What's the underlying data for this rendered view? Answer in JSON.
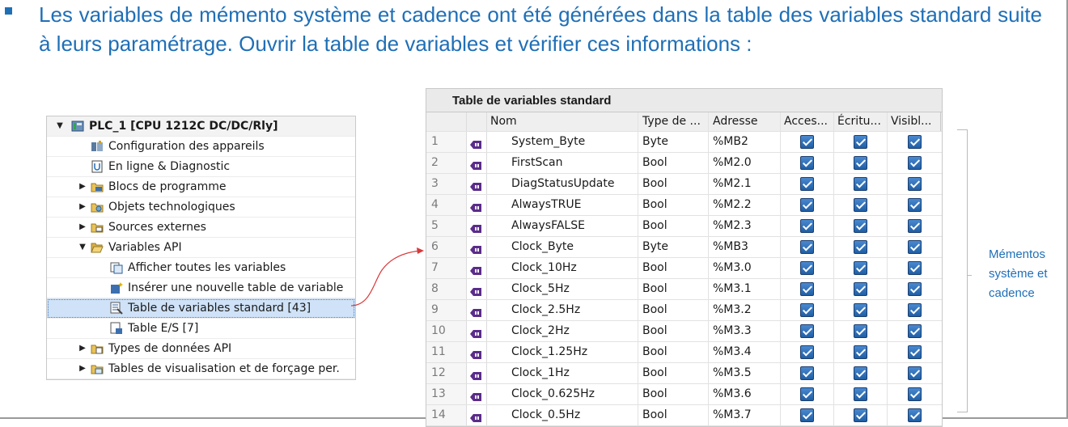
{
  "instruction": {
    "text": "Les variables de mémento système et cadence ont été générées dans la table des variables standard suite à leurs paramétrage. Ouvrir la table de variables et vérifier ces informations :",
    "color": "#1f6fb7"
  },
  "project_tree": {
    "root": {
      "label": "PLC_1 [CPU 1212C DC/DC/Rly]",
      "expanded": true,
      "icon": "plc-icon"
    },
    "items": [
      {
        "label": "Configuration des appareils",
        "level": 1,
        "icon": "device-config-icon",
        "expander": "none"
      },
      {
        "label": "En ligne & Diagnostic",
        "level": 1,
        "icon": "online-diagnostic-icon",
        "expander": "none"
      },
      {
        "label": "Blocs de programme",
        "level": 1,
        "icon": "folder-blocks-icon",
        "expander": "collapsed"
      },
      {
        "label": "Objets technologiques",
        "level": 1,
        "icon": "folder-tech-icon",
        "expander": "collapsed"
      },
      {
        "label": "Sources externes",
        "level": 1,
        "icon": "folder-sources-icon",
        "expander": "collapsed"
      },
      {
        "label": "Variables API",
        "level": 1,
        "icon": "folder-open-icon",
        "expander": "expanded"
      },
      {
        "label": "Afficher toutes les variables",
        "level": 2,
        "icon": "show-all-vars-icon",
        "expander": "none"
      },
      {
        "label": "Insérer une nouvelle table de variable",
        "level": 2,
        "icon": "insert-table-icon",
        "expander": "none"
      },
      {
        "label": "Table de variables standard [43]",
        "level": 2,
        "icon": "var-table-icon",
        "expander": "none",
        "selected": true
      },
      {
        "label": "Table E/S [7]",
        "level": 2,
        "icon": "io-table-icon",
        "expander": "none"
      },
      {
        "label": "Types de données API",
        "level": 1,
        "icon": "folder-types-icon",
        "expander": "collapsed"
      },
      {
        "label": "Tables de visualisation et de forçage per.",
        "level": 1,
        "icon": "folder-watch-icon",
        "expander": "collapsed"
      }
    ]
  },
  "variable_table": {
    "title": "Table de variables standard",
    "columns": {
      "name": "Nom",
      "type": "Type de ...",
      "address": "Adresse",
      "access": "Acces...",
      "write": "Écritu...",
      "visible": "Visibl..."
    },
    "rows": [
      {
        "num": "1",
        "name": "System_Byte",
        "type": "Byte",
        "address": "%MB2",
        "access": true,
        "write": true,
        "visible": true
      },
      {
        "num": "2",
        "name": "FirstScan",
        "type": "Bool",
        "address": "%M2.0",
        "access": true,
        "write": true,
        "visible": true
      },
      {
        "num": "3",
        "name": "DiagStatusUpdate",
        "type": "Bool",
        "address": "%M2.1",
        "access": true,
        "write": true,
        "visible": true
      },
      {
        "num": "4",
        "name": "AlwaysTRUE",
        "type": "Bool",
        "address": "%M2.2",
        "access": true,
        "write": true,
        "visible": true
      },
      {
        "num": "5",
        "name": "AlwaysFALSE",
        "type": "Bool",
        "address": "%M2.3",
        "access": true,
        "write": true,
        "visible": true
      },
      {
        "num": "6",
        "name": "Clock_Byte",
        "type": "Byte",
        "address": "%MB3",
        "access": true,
        "write": true,
        "visible": true
      },
      {
        "num": "7",
        "name": "Clock_10Hz",
        "type": "Bool",
        "address": "%M3.0",
        "access": true,
        "write": true,
        "visible": true
      },
      {
        "num": "8",
        "name": "Clock_5Hz",
        "type": "Bool",
        "address": "%M3.1",
        "access": true,
        "write": true,
        "visible": true
      },
      {
        "num": "9",
        "name": "Clock_2.5Hz",
        "type": "Bool",
        "address": "%M3.2",
        "access": true,
        "write": true,
        "visible": true
      },
      {
        "num": "10",
        "name": "Clock_2Hz",
        "type": "Bool",
        "address": "%M3.3",
        "access": true,
        "write": true,
        "visible": true
      },
      {
        "num": "11",
        "name": "Clock_1.25Hz",
        "type": "Bool",
        "address": "%M3.4",
        "access": true,
        "write": true,
        "visible": true
      },
      {
        "num": "12",
        "name": "Clock_1Hz",
        "type": "Bool",
        "address": "%M3.5",
        "access": true,
        "write": true,
        "visible": true
      },
      {
        "num": "13",
        "name": "Clock_0.625Hz",
        "type": "Bool",
        "address": "%M3.6",
        "access": true,
        "write": true,
        "visible": true
      },
      {
        "num": "14",
        "name": "Clock_0.5Hz",
        "type": "Bool",
        "address": "%M3.7",
        "access": true,
        "write": true,
        "visible": true
      }
    ]
  },
  "side_note": {
    "lines": [
      "Mémentos",
      "système et",
      "cadence"
    ],
    "color": "#1f6fb7"
  },
  "colors": {
    "accent": "#1f6fb7",
    "selection": "#cfe2f7",
    "checkbox": "#2a6db5",
    "connector": "#d9383a"
  }
}
